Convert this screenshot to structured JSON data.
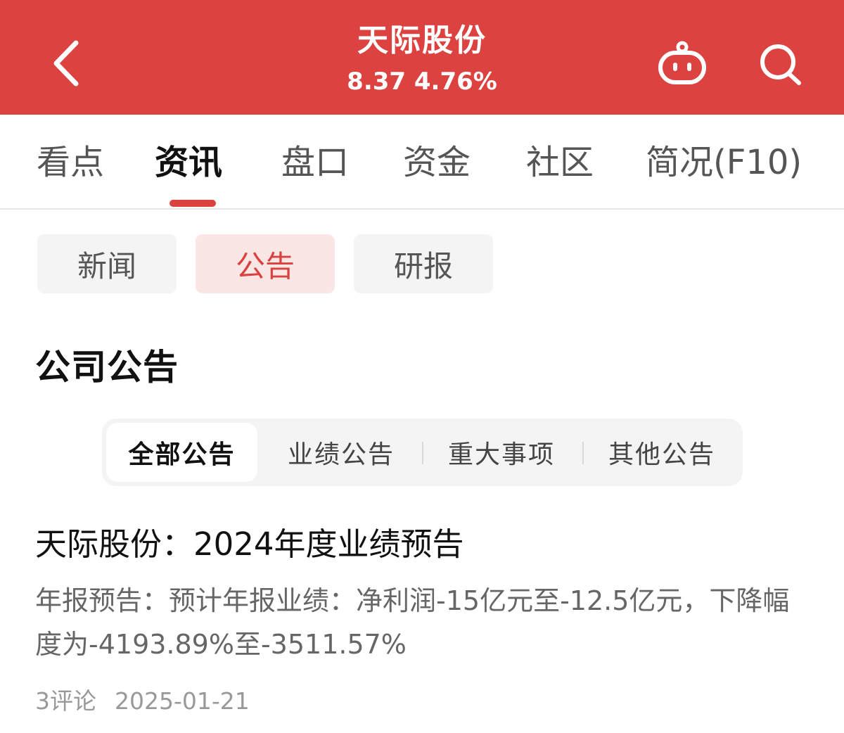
{
  "header": {
    "stock_name": "天际股份",
    "stock_price": "8.37 4.76%",
    "bg_color": "#db4240"
  },
  "icons": {
    "back": "chevron-left-icon",
    "assistant": "robot-icon",
    "search": "search-icon"
  },
  "main_tabs": [
    "看点",
    "资讯",
    "盘口",
    "资金",
    "社区",
    "简况(F10)"
  ],
  "main_tab_active": "资讯",
  "sub_tabs": [
    "新闻",
    "公告",
    "研报"
  ],
  "sub_tab_active": "公告",
  "section_title": "公司公告",
  "filters": [
    "全部公告",
    "业绩公告",
    "重大事项",
    "其他公告"
  ],
  "filter_active": "全部公告",
  "article": {
    "title": "天际股份：2024年度业绩预告",
    "summary": "年报预告：预计年报业绩：净利润-15亿元至-12.5亿元，下降幅度为-4193.89%至-3511.57%",
    "comments": "3评论",
    "date": "2025-01-21"
  },
  "colors": {
    "accent": "#db4240",
    "active_subtab_bg": "#fbe6e6"
  }
}
